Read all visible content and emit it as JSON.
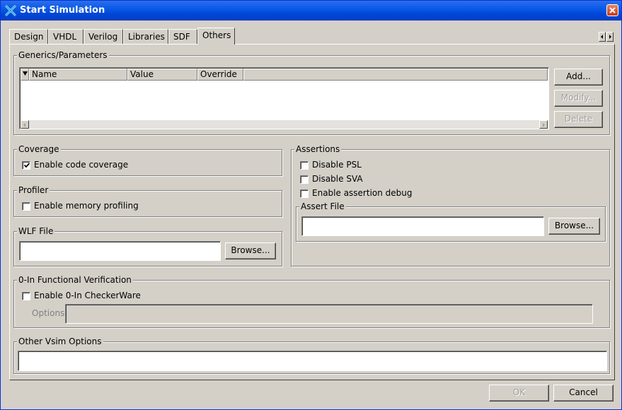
{
  "window": {
    "title": "Start Simulation"
  },
  "tabs": [
    {
      "label": "Design"
    },
    {
      "label": "VHDL"
    },
    {
      "label": "Verilog"
    },
    {
      "label": "Libraries"
    },
    {
      "label": "SDF"
    },
    {
      "label": "Others",
      "active": true
    }
  ],
  "generics": {
    "group_label": "Generics/Parameters",
    "columns": [
      "Name",
      "Value",
      "Override"
    ],
    "rows": [],
    "add_label": "Add...",
    "modify_label": "Modify...",
    "delete_label": "Delete"
  },
  "coverage": {
    "group_label": "Coverage",
    "enable_label": "Enable code coverage",
    "checked": true
  },
  "profiler": {
    "group_label": "Profiler",
    "enable_label": "Enable memory profiling",
    "checked": false
  },
  "wlf": {
    "group_label": "WLF File",
    "value": "",
    "browse_label": "Browse..."
  },
  "assertions": {
    "group_label": "Assertions",
    "disable_psl_label": "Disable PSL",
    "disable_sva_label": "Disable SVA",
    "enable_debug_label": "Enable assertion debug",
    "assert_file": {
      "group_label": "Assert File",
      "value": "",
      "browse_label": "Browse..."
    }
  },
  "zero_in": {
    "group_label": "0-In Functional Verification",
    "enable_label": "Enable 0-In CheckerWare",
    "options_label": "Options",
    "options_value": ""
  },
  "other_vsim": {
    "group_label": "Other Vsim Options",
    "value": ""
  },
  "footer": {
    "ok_label": "OK",
    "cancel_label": "Cancel"
  },
  "colors": {
    "titlebar": "#0a5ae8",
    "face": "#d4d0c8"
  }
}
